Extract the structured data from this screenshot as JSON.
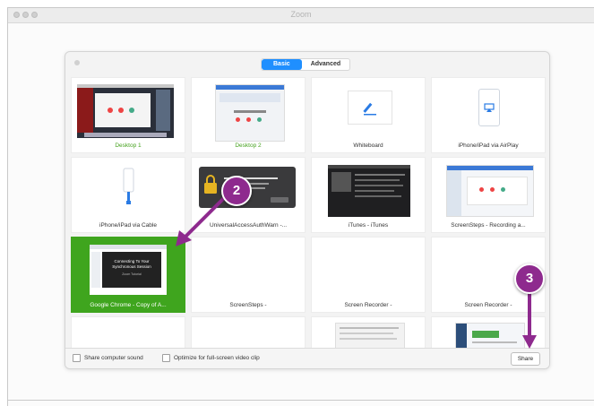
{
  "window": {
    "title": "Zoom"
  },
  "tabs": {
    "basic": "Basic",
    "advanced": "Advanced"
  },
  "tiles": [
    {
      "label": "Desktop 1",
      "selected": false,
      "green_label": true
    },
    {
      "label": "Desktop 2",
      "selected": false,
      "green_label": true
    },
    {
      "label": "Whiteboard",
      "selected": false
    },
    {
      "label": "iPhone/iPad via AirPlay",
      "selected": false
    },
    {
      "label": "iPhone/iPad via Cable",
      "selected": false
    },
    {
      "label": "UniversalAccessAuthWarn -...",
      "selected": false
    },
    {
      "label": "iTunes - iTunes",
      "selected": false
    },
    {
      "label": "ScreenSteps - Recording a...",
      "selected": false
    },
    {
      "label": "Google Chrome - Copy of A...",
      "selected": true
    },
    {
      "label": "ScreenSteps -",
      "selected": false
    },
    {
      "label": "Screen Recorder -",
      "selected": false
    },
    {
      "label": "Screen Recorder -",
      "selected": false
    },
    {
      "label": "",
      "selected": false
    },
    {
      "label": "",
      "selected": false
    },
    {
      "label": "",
      "selected": false
    },
    {
      "label": "",
      "selected": false
    }
  ],
  "thumb_text": {
    "chrome_slide": "Connecting To Your Synchronous Session",
    "chrome_slide_sub": "Zoom Tutorial"
  },
  "bottom": {
    "share_sound": "Share computer sound",
    "optimize_video": "Optimize for full-screen video clip",
    "share_button": "Share"
  },
  "callouts": {
    "step2": "2",
    "step3": "3"
  },
  "colors": {
    "accent": "#1f8fff",
    "selected": "#3fa51e",
    "callout": "#8e2a8e"
  }
}
